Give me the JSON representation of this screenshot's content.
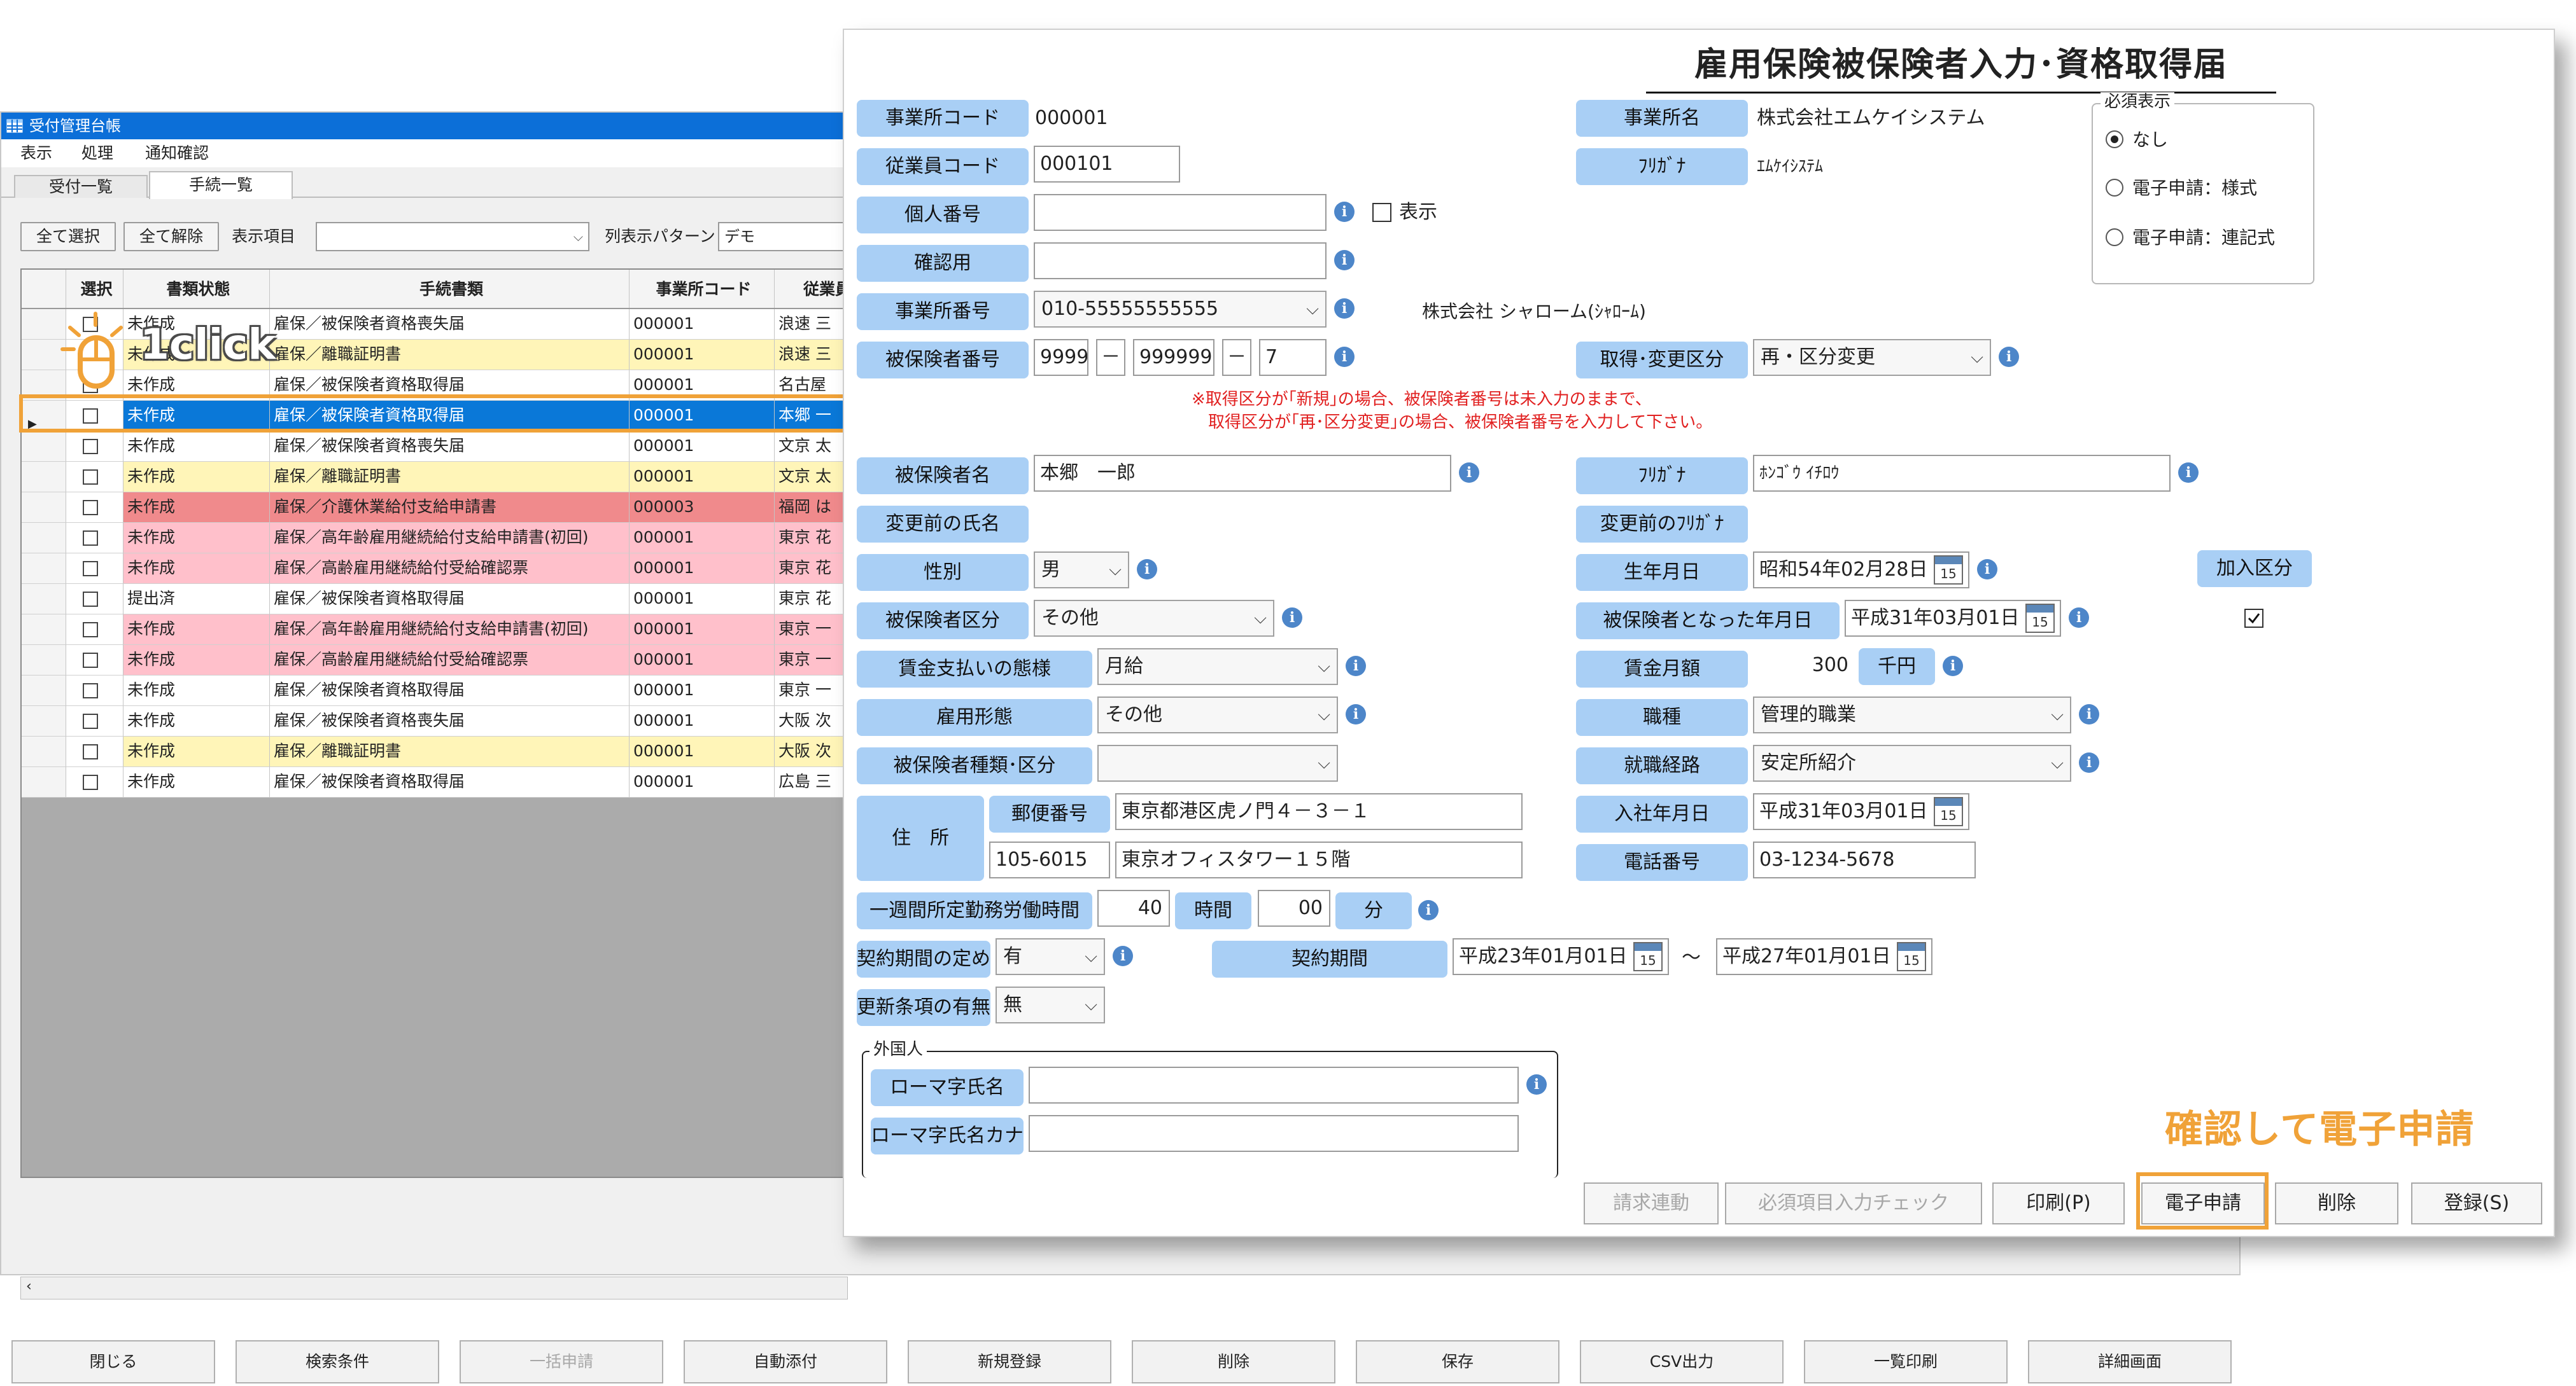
{
  "list_window": {
    "title": "受付管理台帳",
    "menu": [
      "表示",
      "処理",
      "通知確認"
    ],
    "tabs": [
      {
        "label": "受付一覧"
      },
      {
        "label": "手続一覧"
      }
    ],
    "toolbar": {
      "select_all": "全て選択",
      "deselect_all": "全て解除",
      "display_items_label": "表示項目",
      "display_items_value": "",
      "column_pattern_label": "列表示パターン",
      "column_pattern_value": "デモ"
    },
    "grid": {
      "headers": [
        "選択",
        "書類状態",
        "手続書類",
        "事業所コード",
        "従業員"
      ],
      "rows": [
        {
          "status": "未作成",
          "doc": "雇保／被保険者資格喪失届",
          "code": "000001",
          "emp": "浪速 三",
          "color": "#ffffff"
        },
        {
          "status": "未作成",
          "doc": "雇保／離職証明書",
          "code": "000001",
          "emp": "浪速 三",
          "color": "#fff5b8"
        },
        {
          "status": "未作成",
          "doc": "雇保／被保険者資格取得届",
          "code": "000001",
          "emp": "名古屋",
          "color": "#ffffff"
        },
        {
          "status": "未作成",
          "doc": "雇保／被保険者資格取得届",
          "code": "000001",
          "emp": "本郷 一",
          "color": "#0a78d8"
        },
        {
          "status": "未作成",
          "doc": "雇保／被保険者資格喪失届",
          "code": "000001",
          "emp": "文京 太",
          "color": "#ffffff"
        },
        {
          "status": "未作成",
          "doc": "雇保／離職証明書",
          "code": "000001",
          "emp": "文京 太",
          "color": "#fff5b8"
        },
        {
          "status": "未作成",
          "doc": "雇保／介護休業給付支給申請書",
          "code": "000003",
          "emp": "福岡 は",
          "color": "#f08a8c"
        },
        {
          "status": "未作成",
          "doc": "雇保／高年齢雇用継続給付支給申請書(初回)",
          "code": "000001",
          "emp": "東京 花",
          "color": "#ffc0cb"
        },
        {
          "status": "未作成",
          "doc": "雇保／高齢雇用継続給付受給確認票",
          "code": "000001",
          "emp": "東京 花",
          "color": "#ffc0cb"
        },
        {
          "status": "提出済",
          "doc": "雇保／被保険者資格取得届",
          "code": "000001",
          "emp": "東京 花",
          "color": "#ffffff"
        },
        {
          "status": "未作成",
          "doc": "雇保／高年齢雇用継続給付支給申請書(初回)",
          "code": "000001",
          "emp": "東京 一",
          "color": "#ffc0cb"
        },
        {
          "status": "未作成",
          "doc": "雇保／高齢雇用継続給付受給確認票",
          "code": "000001",
          "emp": "東京 一",
          "color": "#ffc0cb"
        },
        {
          "status": "未作成",
          "doc": "雇保／被保険者資格取得届",
          "code": "000001",
          "emp": "東京 一",
          "color": "#ffffff"
        },
        {
          "status": "未作成",
          "doc": "雇保／被保険者資格喪失届",
          "code": "000001",
          "emp": "大阪 次",
          "color": "#ffffff"
        },
        {
          "status": "未作成",
          "doc": "雇保／離職証明書",
          "code": "000001",
          "emp": "大阪 次",
          "color": "#fff5b8"
        },
        {
          "status": "未作成",
          "doc": "雇保／被保険者資格取得届",
          "code": "000001",
          "emp": "広島 三",
          "color": "#ffffff"
        }
      ]
    },
    "bottom_buttons": [
      "閉じる",
      "検索条件",
      "一括申請",
      "自動添付",
      "新規登録",
      "削除",
      "保存",
      "CSV出力",
      "一覧印刷",
      "詳細画面"
    ],
    "overlay": {
      "label": "1click"
    }
  },
  "form": {
    "title": "雇用保険被保険者入力･資格取得届",
    "office_code": {
      "label": "事業所コード",
      "value": "000001"
    },
    "office_name": {
      "label": "事業所名",
      "value": "株式会社エムケイシステム"
    },
    "office_kana": {
      "label": "ﾌﾘｶﾞﾅ",
      "value": "ｴﾑｹｲｼｽﾃﾑ"
    },
    "employee_code": {
      "label": "従業員コード",
      "value": "000101"
    },
    "personal_number": {
      "label": "個人番号",
      "value": "",
      "show_label": "表示"
    },
    "confirm": {
      "label": "確認用",
      "value": ""
    },
    "office_number": {
      "label": "事業所番号",
      "value": "010-55555555555",
      "company": "株式会社 シャローム(ｼｬﾛｰﾑ)"
    },
    "insured_number": {
      "label": "被保険者番号",
      "part1": "9999",
      "part2": "999999",
      "part3": "7"
    },
    "acquisition_type": {
      "label": "取得･変更区分",
      "value": "再・区分変更"
    },
    "note_line1": "※取得区分が｢新規｣の場合、被保険者番号は未入力のままで、",
    "note_line2": "取得区分が｢再･区分変更｣の場合、被保険者番号を入力して下さい。",
    "insured_name": {
      "label": "被保険者名",
      "value": "本郷　一郎"
    },
    "insured_kana": {
      "label": "ﾌﾘｶﾞﾅ",
      "value": "ﾎﾝｺﾞｳ ｲﾁﾛｳ"
    },
    "prev_name": {
      "label": "変更前の氏名"
    },
    "prev_kana": {
      "label": "変更前のﾌﾘｶﾞﾅ"
    },
    "gender": {
      "label": "性別",
      "value": "男"
    },
    "birthdate": {
      "label": "生年月日",
      "value": "昭和54年02月28日"
    },
    "join_category": {
      "label": "加入区分"
    },
    "insured_category": {
      "label": "被保険者区分",
      "value": "その他"
    },
    "insured_date": {
      "label": "被保険者となった年月日",
      "value": "平成31年03月01日"
    },
    "wage_payment": {
      "label": "賃金支払いの態様",
      "value": "月給"
    },
    "wage_monthly": {
      "label": "賃金月額",
      "value": "300",
      "unit": "千円"
    },
    "employment_type": {
      "label": "雇用形態",
      "value": "その他"
    },
    "occupation": {
      "label": "職種",
      "value": "管理的職業"
    },
    "insured_kind": {
      "label": "被保険者種類･区分",
      "value": ""
    },
    "job_route": {
      "label": "就職経路",
      "value": "安定所紹介"
    },
    "address": {
      "label": "住　所",
      "postal_label": "郵便番号",
      "postal": "105-6015",
      "line1": "東京都港区虎ノ門４－３－１",
      "line2": "東京オフィスタワー１５階"
    },
    "hire_date": {
      "label": "入社年月日",
      "value": "平成31年03月01日"
    },
    "phone": {
      "label": "電話番号",
      "value": "03-1234-5678"
    },
    "weekly_hours": {
      "label": "一週間所定勤務労働時間",
      "hours": "40",
      "hours_unit": "時間",
      "minutes": "00",
      "minutes_unit": "分"
    },
    "contract_term": {
      "label": "契約期間の定め",
      "value": "有"
    },
    "contract_period": {
      "label": "契約期間",
      "from": "平成23年01月01日",
      "tilde": "～",
      "to": "平成27年01月01日"
    },
    "renewal": {
      "label": "更新条項の有無",
      "value": "無"
    },
    "foreigner": {
      "legend": "外国人",
      "roman_name_label": "ローマ字氏名",
      "roman_name_value": "",
      "roman_kana_label": "ローマ字氏名カナ",
      "roman_kana_value": ""
    },
    "required_display": {
      "legend": "必須表示",
      "options": [
        {
          "label": "なし",
          "selected": true
        },
        {
          "label": "電子申請：様式",
          "selected": false
        },
        {
          "label": "電子申請：連記式",
          "selected": false
        }
      ]
    },
    "calendar_day": "15",
    "buttons": {
      "billing": "請求連動",
      "required_check": "必須項目入力チェック",
      "print": "印刷(P)",
      "e_apply": "電子申請",
      "delete": "削除",
      "register": "登録(S)"
    },
    "caption": "確認して電子申請"
  },
  "colors": {
    "label_bg": "#a9cff5",
    "highlight": "#f0a238",
    "selected_row": "#0a78d8",
    "titlebar": "#0c6fd8"
  }
}
